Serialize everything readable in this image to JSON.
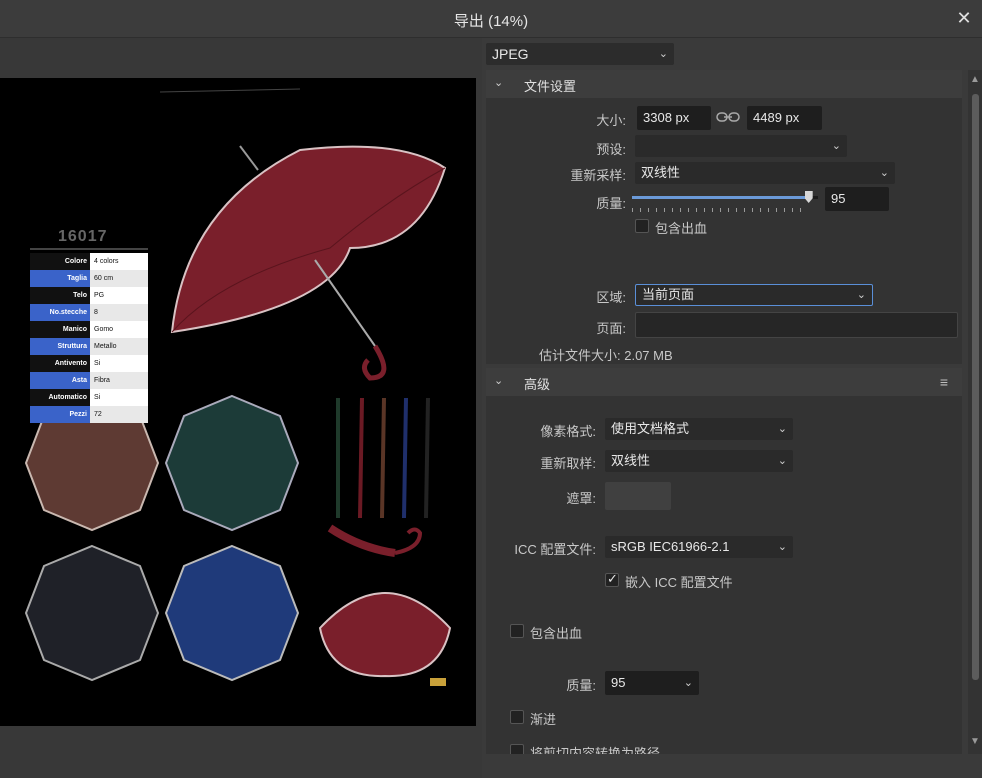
{
  "titlebar": {
    "title": "导出 (14%)",
    "close_icon": "close-icon"
  },
  "format": {
    "value": "JPEG"
  },
  "file_settings": {
    "header": "文件设置",
    "size_label": "大小:",
    "width": "3308 px",
    "height": "4489 px",
    "preset_label": "预设:",
    "preset_value": "",
    "resample_label": "重新采样:",
    "resample_value": "双线性",
    "quality_label": "质量:",
    "quality_value": "95",
    "quality_fraction": 0.95,
    "bleed_label": "包含出血",
    "area_label": "区域:",
    "area_value": "当前页面",
    "pages_label": "页面:",
    "pages_value": "",
    "estimate": "估计文件大小: 2.07 MB"
  },
  "advanced": {
    "header": "高级",
    "pixel_format_label": "像素格式:",
    "pixel_format_value": "使用文档格式",
    "resample_label": "重新取样:",
    "resample_value": "双线性",
    "matte_label": "遮罩:",
    "icc_label": "ICC 配置文件:",
    "icc_value": "sRGB IEC61966-2.1",
    "embed_icc_label": "嵌入 ICC 配置文件",
    "bleed_label": "包含出血",
    "quality_label": "质量:",
    "quality_value": "95",
    "progressive_label": "渐进",
    "clip_label": "将剪切内容转换为路径"
  },
  "preview": {
    "model": "16017",
    "specs": [
      {
        "k": "Colore",
        "v": "4 colors"
      },
      {
        "k": "Taglia",
        "v": "60 cm"
      },
      {
        "k": "Telo",
        "v": "PG"
      },
      {
        "k": "No.stecche",
        "v": "8"
      },
      {
        "k": "Manico",
        "v": "Gomo"
      },
      {
        "k": "Struttura",
        "v": "Metallo"
      },
      {
        "k": "Antivento",
        "v": "Si"
      },
      {
        "k": "Asta",
        "v": "Fibra"
      },
      {
        "k": "Automatico",
        "v": "Si"
      },
      {
        "k": "Pezzi",
        "v": "72"
      }
    ]
  }
}
